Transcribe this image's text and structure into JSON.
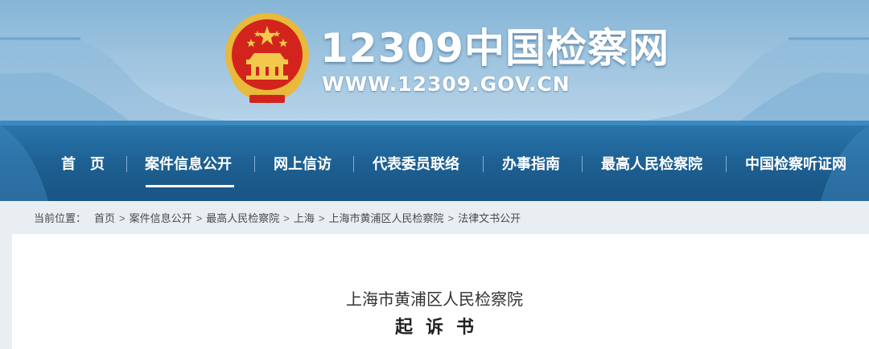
{
  "header": {
    "site_title": "12309中国检察网",
    "site_url": "WWW.12309.GOV.CN"
  },
  "nav": {
    "items": [
      {
        "label": "首　页",
        "active": false
      },
      {
        "label": "案件信息公开",
        "active": true
      },
      {
        "label": "网上信访",
        "active": false
      },
      {
        "label": "代表委员联络",
        "active": false
      },
      {
        "label": "办事指南",
        "active": false
      },
      {
        "label": "最高人民检察院",
        "active": false
      },
      {
        "label": "中国检察听证网",
        "active": false
      }
    ]
  },
  "breadcrumb": {
    "prefix": "当前位置：",
    "items": [
      "首页",
      "案件信息公开",
      "最高人民检察院",
      "上海",
      "上海市黄浦区人民检察院",
      "法律文书公开"
    ],
    "separator": ">"
  },
  "document": {
    "organization": "上海市黄浦区人民检察院",
    "title": "起诉书"
  },
  "colors": {
    "nav_background": "#1d5f91",
    "header_sky": "#9cc3df",
    "emblem_red": "#d2241c",
    "emblem_gold": "#e8b93a"
  }
}
